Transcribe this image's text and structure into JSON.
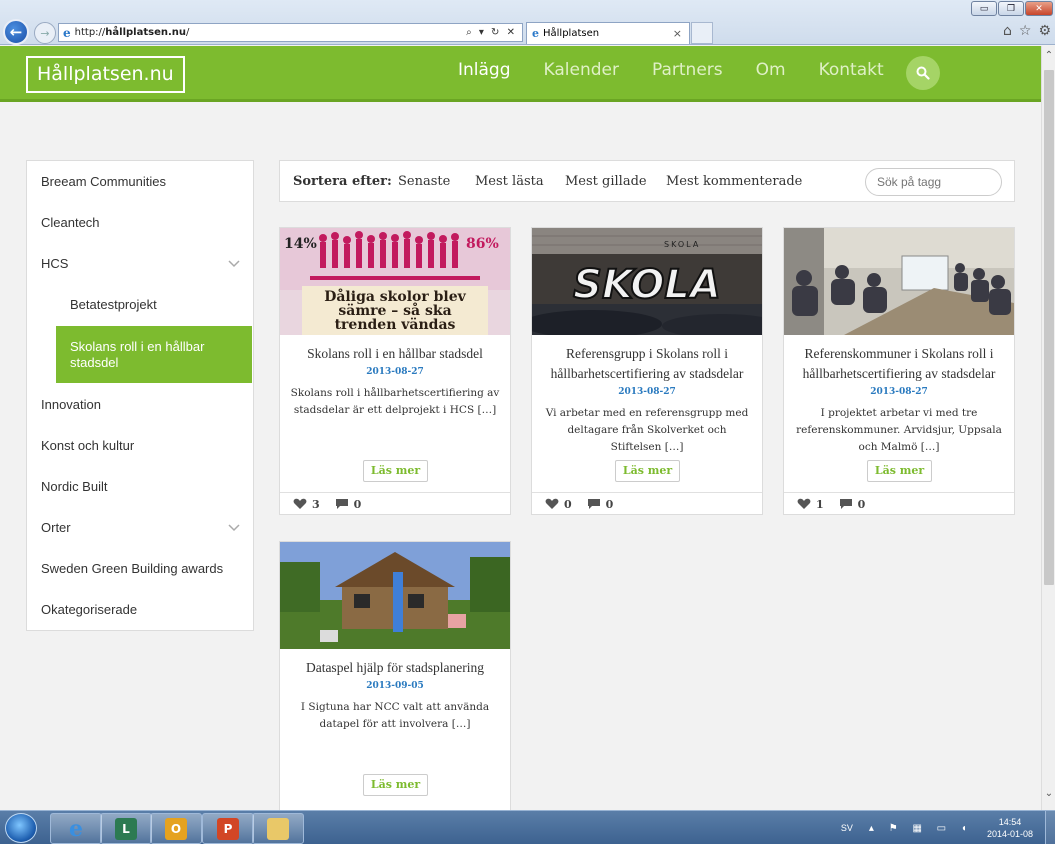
{
  "browser": {
    "url": "http://hållplatsen.nu/",
    "url_prefix": "http://",
    "url_host": "hållplatsen.nu",
    "url_suffix": "/",
    "tab_title": "Hållplatsen",
    "win_minimize": "▭",
    "win_restore": "❐",
    "win_close": "✕",
    "addr_tools": "⌕ ▾ ↻ ✕",
    "tab_close": "×"
  },
  "site": {
    "logo": "Hållplatsen.nu",
    "nav": [
      "Inlägg",
      "Kalender",
      "Partners",
      "Om",
      "Kontakt"
    ],
    "nav_active": "Inlägg",
    "accent_color": "#7dbb2f"
  },
  "sidebar": {
    "items": [
      {
        "label": "Breeam Communities"
      },
      {
        "label": "Cleantech"
      },
      {
        "label": "HCS"
      },
      {
        "label": "Betatestprojekt"
      },
      {
        "label": "Skolans roll i en hållbar stadsdel"
      },
      {
        "label": "Innovation"
      },
      {
        "label": "Konst och kultur"
      },
      {
        "label": "Nordic Built"
      },
      {
        "label": "Orter"
      },
      {
        "label": "Sweden Green Building awards"
      },
      {
        "label": "Okategoriserade"
      }
    ]
  },
  "sortbar": {
    "label": "Sortera efter:",
    "options": [
      "Senaste",
      "Mest lästa",
      "Mest gillade",
      "Mest kommenterade"
    ],
    "search_placeholder": "Sök på tagg"
  },
  "posts": [
    {
      "title": "Skolans roll i en hållbar stadsdel",
      "date": "2013-08-27",
      "excerpt": "Skolans roll i hållbarhetscertifiering av stadsdelar är ett delprojekt i HCS […]",
      "read_more": "Läs mer",
      "likes": "3",
      "comments": "0",
      "image_text": {
        "pct_left": "14%",
        "pct_right": "86%",
        "line1": "Dåliga skolor blev",
        "line2": "sämre – så ska",
        "line3": "trenden vändas"
      }
    },
    {
      "title": "Referensgrupp i Skolans roll i hållbarhetscertifiering av stadsdelar",
      "date": "2013-08-27",
      "excerpt": "Vi arbetar med en referensgrupp med deltagare från Skolverket och Stiftelsen […]",
      "read_more": "Läs mer",
      "likes": "0",
      "comments": "0",
      "image_text": {
        "graffiti": "SKOLA",
        "sign": "SKOLA"
      }
    },
    {
      "title": "Referenskommuner i Skolans roll i hållbarhetscertifiering av stadsdelar",
      "date": "2013-08-27",
      "excerpt": "I projektet arbetar vi med tre referenskommuner. Arvidsjur, Uppsala och Malmö […]",
      "read_more": "Läs mer",
      "likes": "1",
      "comments": "0"
    },
    {
      "title": "Dataspel hjälp för stadsplanering",
      "date": "2013-09-05",
      "excerpt": "I Sigtuna har NCC valt att använda datapel för att involvera […]",
      "read_more": "Läs mer"
    }
  ],
  "taskbar": {
    "language": "SV",
    "time": "14:54",
    "date": "2014-01-08",
    "apps": [
      "windows-start",
      "internet-explorer",
      "network-app",
      "outlook",
      "powerpoint",
      "file-explorer"
    ]
  }
}
